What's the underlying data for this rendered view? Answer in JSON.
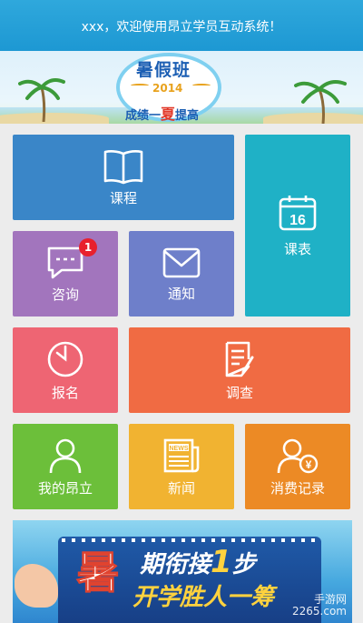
{
  "header": {
    "welcome": "xxx，欢迎使用昂立学员互动系统！"
  },
  "banner": {
    "title": "暑假班",
    "year": "2014",
    "slogan_pre": "成绩一",
    "slogan_mid": "夏",
    "slogan_post": "提高"
  },
  "tiles": {
    "course": {
      "label": "课程",
      "icon": "book-icon"
    },
    "schedule": {
      "label": "课表",
      "icon": "calendar-icon",
      "day": "16"
    },
    "consult": {
      "label": "咨询",
      "icon": "chat-icon",
      "badge": "1"
    },
    "notice": {
      "label": "通知",
      "icon": "mail-icon"
    },
    "signup": {
      "label": "报名",
      "icon": "clock-icon"
    },
    "survey": {
      "label": "调查",
      "icon": "document-edit-icon"
    },
    "mine": {
      "label": "我的昂立",
      "icon": "user-icon"
    },
    "news": {
      "label": "新闻",
      "icon": "newspaper-icon",
      "news_tag": "NEWS"
    },
    "spend": {
      "label": "消费记录",
      "icon": "user-yen-icon",
      "currency": "¥"
    }
  },
  "promo": {
    "big_char": "暑",
    "line1_pre": "期衔接",
    "line1_num": "1",
    "line1_post": "步",
    "line2": "开学胜人一筹",
    "watermark_line1": "手游网",
    "watermark_line2": "2265.com"
  },
  "colors": {
    "header": "#1d98d3",
    "course": "#3a86c8",
    "schedule": "#1fb1c6",
    "consult": "#a275bd",
    "notice": "#6e7fca",
    "signup": "#ee6573",
    "survey": "#f06b43",
    "mine": "#6cbf3a",
    "news": "#f1b331",
    "spend": "#ec8a25"
  }
}
